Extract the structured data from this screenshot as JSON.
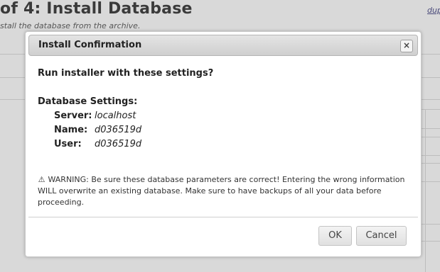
{
  "background": {
    "page_title": "of 4: Install Database",
    "page_subtitle": "stall the database from the archive.",
    "corner_link": "dup"
  },
  "dialog": {
    "title": "Install Confirmation",
    "close_symbol": "×",
    "question": "Run installer with these settings?",
    "db_heading": "Database Settings:",
    "settings": [
      {
        "label": "Server:",
        "value": "localhost"
      },
      {
        "label": "Name:",
        "value": "d036519d"
      },
      {
        "label": "User:",
        "value": "d036519d"
      }
    ],
    "warning_icon": "⚠",
    "warning_text": "WARNING: Be sure these database parameters are correct! Entering the wrong information WILL overwrite an existing database. Make sure to have backups of all your data before proceeding.",
    "ok_label": "OK",
    "cancel_label": "Cancel"
  }
}
